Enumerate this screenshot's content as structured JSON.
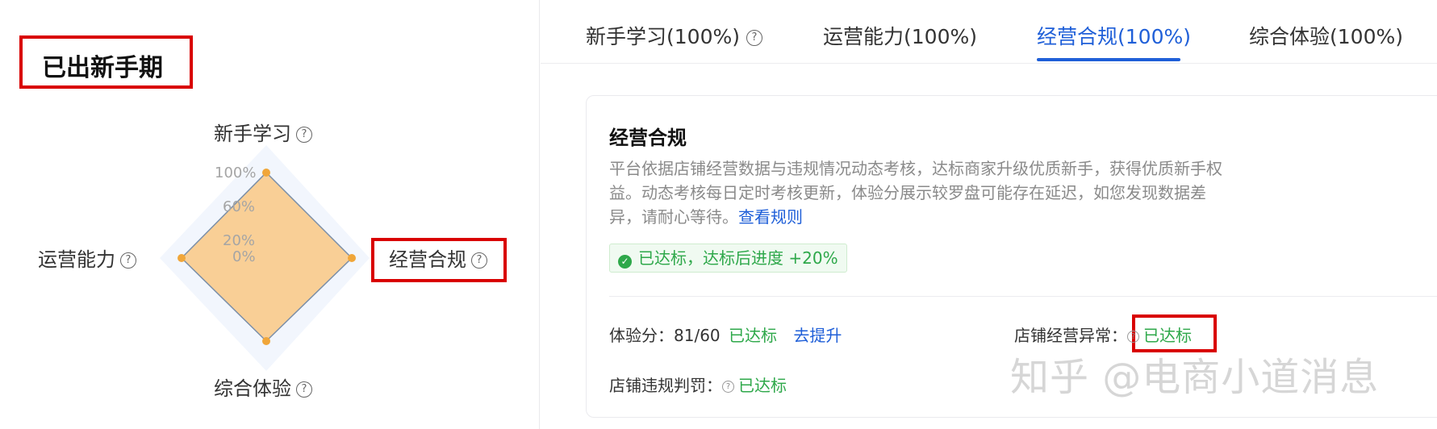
{
  "left": {
    "stage_title": "已出新手期",
    "axes": {
      "top": "新手学习",
      "left": "运营能力",
      "right": "经营合规",
      "bottom": "综合体验"
    },
    "scale_labels": [
      "100%",
      "60%",
      "20%",
      "0%"
    ],
    "radar_values": {
      "新手学习": 100,
      "经营合规": 100,
      "综合体验": 100,
      "运营能力": 100
    },
    "fill_color": "#f9cf96",
    "point_color": "#f0a63a"
  },
  "tabs": [
    {
      "label": "新手学习(100%)",
      "has_help": true
    },
    {
      "label": "运营能力(100%)",
      "has_help": false
    },
    {
      "label": "经营合规(100%)",
      "has_help": false,
      "active": true
    },
    {
      "label": "综合体验(100%)",
      "has_help": false
    }
  ],
  "card": {
    "title": "经营合规",
    "description": "平台依据店铺经营数据与违规情况动态考核，达标商家升级优质新手，获得优质新手权益。动态考核每日定时考核更新，体验分展示较罗盘可能存在延迟，如您发现数据差异，请耐心等待。",
    "rules_link": "查看规则",
    "status": "已达标，达标后进度 +20%",
    "metrics": {
      "experience_label": "体验分：",
      "experience_value": "81/60",
      "experience_status": "已达标",
      "improve_link": "去提升",
      "abnormal_label": "店铺经营异常：",
      "abnormal_status": "已达标",
      "violation_label": "店铺违规判罚：",
      "violation_status": "已达标"
    }
  },
  "watermark": "知乎 @电商小道消息",
  "colors": {
    "accent": "#1f5fd8",
    "success": "#2ea84a",
    "highlight_border": "#d90000"
  }
}
